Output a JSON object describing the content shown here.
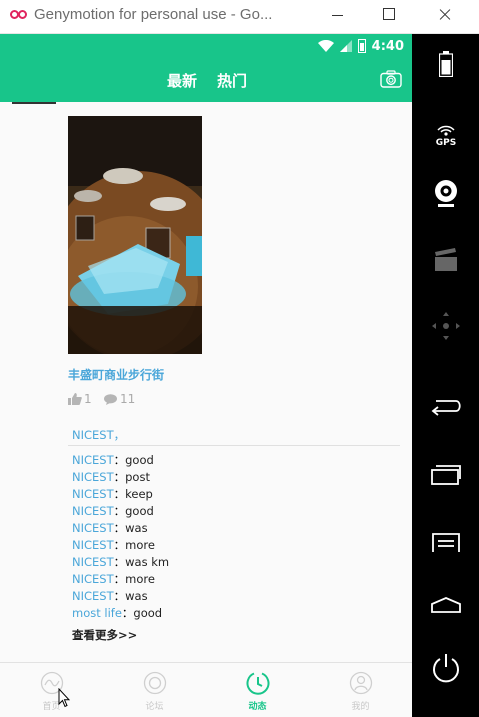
{
  "window": {
    "title": "Genymotion for personal use - Go..."
  },
  "status_bar": {
    "time": "4:40"
  },
  "header": {
    "tabs": [
      "最新",
      "热门"
    ]
  },
  "post": {
    "location": "丰盛町商业步行街",
    "likes": "1",
    "comments": "11",
    "likers": "NICEST，",
    "comment_list": [
      {
        "author": "NICEST",
        "text": "good"
      },
      {
        "author": "NICEST",
        "text": "post"
      },
      {
        "author": "NICEST",
        "text": "keep"
      },
      {
        "author": "NICEST",
        "text": "good"
      },
      {
        "author": "NICEST",
        "text": "was"
      },
      {
        "author": "NICEST",
        "text": "more"
      },
      {
        "author": "NICEST",
        "text": "was km"
      },
      {
        "author": "NICEST",
        "text": "more"
      },
      {
        "author": "NICEST",
        "text": "was"
      },
      {
        "author": "most life",
        "text": "good"
      }
    ],
    "separator": "：",
    "see_more": "查看更多>>"
  },
  "bottom_nav": [
    {
      "label": "首页",
      "icon": "home-icon",
      "active": false
    },
    {
      "label": "论坛",
      "icon": "forum-icon",
      "active": false
    },
    {
      "label": "动态",
      "icon": "moments-icon",
      "active": true
    },
    {
      "label": "我的",
      "icon": "profile-icon",
      "active": false
    }
  ],
  "emulator_panel": {
    "gps_label": "GPS",
    "buttons": [
      "battery-icon",
      "gps-icon",
      "webcam-icon",
      "clapperboard-icon",
      "dpad-icon",
      "back-icon",
      "recent-apps-icon",
      "menu-icon",
      "home-icon",
      "power-icon"
    ]
  },
  "colors": {
    "accent": "#18c58a",
    "link": "#4aa6d9"
  }
}
